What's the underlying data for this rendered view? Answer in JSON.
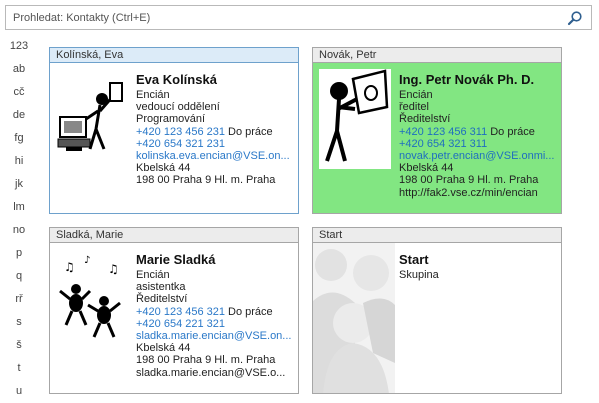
{
  "search": {
    "placeholder": "Prohledat: Kontakty (Ctrl+E)"
  },
  "alphabet": [
    "123",
    "ab",
    "cč",
    "de",
    "fg",
    "hi",
    "jk",
    "lm",
    "no",
    "p",
    "q",
    "rř",
    "s",
    "š",
    "t",
    "u"
  ],
  "cards": [
    {
      "header": "Kolínská, Eva",
      "name": "Eva Kolínská",
      "company": "Encián",
      "title": "vedoucí oddělení",
      "department": "Programování",
      "phone1": "+420 123 456 231",
      "phone1_label": "Do práce",
      "phone2": "+420 654 321 231",
      "email": "kolinska.eva.encian@VSE.on...",
      "street": "Kbelská 44",
      "city": "198 00  Praha 9  Hl. m. Praha",
      "picture_icon": "computer-user-clipart"
    },
    {
      "header": "Novák, Petr",
      "name": "Ing. Petr Novák Ph. D.",
      "company": "Encián",
      "title": "ředitel",
      "department": "Ředitelství",
      "phone1": "+420 123 456 311",
      "phone1_label": "Do práce",
      "phone2": "+420 654 321 311",
      "email": "novak.petr.encian@VSE.onmi...",
      "street": "Kbelská 44",
      "city": "198 00  Praha 9  Hl. m. Praha",
      "web": "http://fak2.vse.cz/min/encian",
      "picture_icon": "person-holding-sign-clipart",
      "highlight_color": "#82e682"
    },
    {
      "header": "Sladká, Marie",
      "name": "Marie Sladká",
      "company": "Encián",
      "title": "asistentka",
      "department": "Ředitelství",
      "phone1": "+420 123 456 321",
      "phone1_label": "Do práce",
      "phone2": "+420 654 221 321",
      "email": "sladka.marie.encian@VSE.on...",
      "street": "Kbelská 44",
      "city": "198 00  Praha 9  Hl. m. Praha",
      "email2": "sladka.marie.encian@VSE.o...",
      "picture_icon": "dancing-people-music-clipart"
    },
    {
      "header": "Start",
      "name": "Start",
      "subtitle": "Skupina",
      "picture_icon": "group-placeholder-icon"
    }
  ],
  "colors": {
    "accent": "#2a78c8",
    "selected_border": "#6ea1cc",
    "green": "#82e682"
  }
}
